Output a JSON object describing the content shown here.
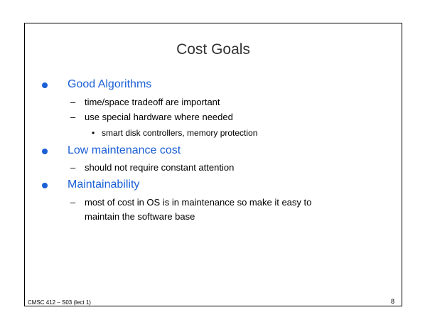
{
  "slide": {
    "title": "Cost Goals",
    "bullets": [
      {
        "label": "Good Algorithms",
        "sub": [
          {
            "text": "time/space tradeoff are important"
          },
          {
            "text": "use special hardware where needed",
            "sub": [
              {
                "text": "smart disk controllers, memory protection"
              }
            ]
          }
        ]
      },
      {
        "label": "Low maintenance cost",
        "sub": [
          {
            "text": "should not require constant attention"
          }
        ]
      },
      {
        "label": "Maintainability",
        "sub": [
          {
            "line1": "most of cost in OS is in maintenance so make it easy to",
            "line2": "maintain the software base"
          }
        ]
      }
    ],
    "footer_left": "CMSC 412 – S03 (lect 1)",
    "page_number": "8",
    "bullet_symbols": {
      "level1": "•",
      "level2": "–",
      "level3": "•"
    },
    "colors": {
      "level1_text": "#1a5fd6",
      "title": "#333333",
      "body": "#000000"
    }
  }
}
